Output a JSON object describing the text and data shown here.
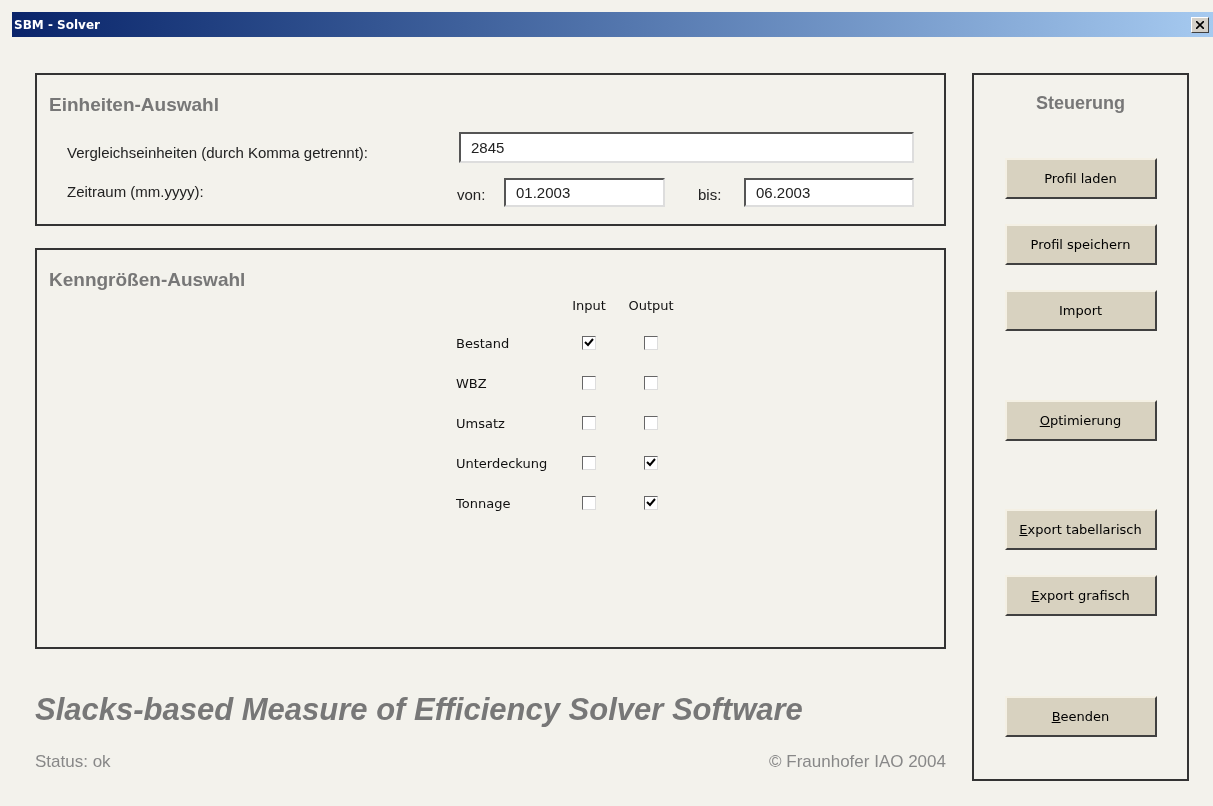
{
  "window": {
    "title": "SBM - Solver"
  },
  "units": {
    "heading": "Einheiten-Auswahl",
    "compare_label": "Vergleichseinheiten (durch Komma getrennt):",
    "compare_value": "2845",
    "period_label": "Zeitraum (mm.yyyy):",
    "from_label": "von:",
    "from_value": "01.2003",
    "to_label": "bis:",
    "to_value": "06.2003"
  },
  "metrics": {
    "heading": "Kenngrößen-Auswahl",
    "columns": [
      "Input",
      "Output"
    ],
    "rows": [
      {
        "label": "Bestand",
        "input_checked": true,
        "output_checked": false
      },
      {
        "label": "WBZ",
        "input_checked": false,
        "output_checked": false
      },
      {
        "label": "Umsatz",
        "input_checked": false,
        "output_checked": false
      },
      {
        "label": "Unterdeckung",
        "input_checked": false,
        "output_checked": true
      },
      {
        "label": "Tonnage",
        "input_checked": false,
        "output_checked": true
      }
    ]
  },
  "control": {
    "heading": "Steuerung",
    "groups": [
      [
        {
          "label": "Profil laden",
          "mnemonic": false
        },
        {
          "label": "Profil speichern",
          "mnemonic": false
        },
        {
          "label": "Import",
          "mnemonic": false
        }
      ],
      [
        {
          "label": "Optimierung",
          "mnemonic": true
        }
      ],
      [
        {
          "label": "Export tabellarisch",
          "mnemonic": true
        },
        {
          "label": "Export grafisch",
          "mnemonic": true
        }
      ],
      [
        {
          "label": "Beenden",
          "mnemonic": true
        }
      ]
    ]
  },
  "footer": {
    "title": "Slacks-based Measure of Efficiency Solver Software",
    "status": "Status: ok",
    "copyright": "© Fraunhofer IAO 2004"
  }
}
